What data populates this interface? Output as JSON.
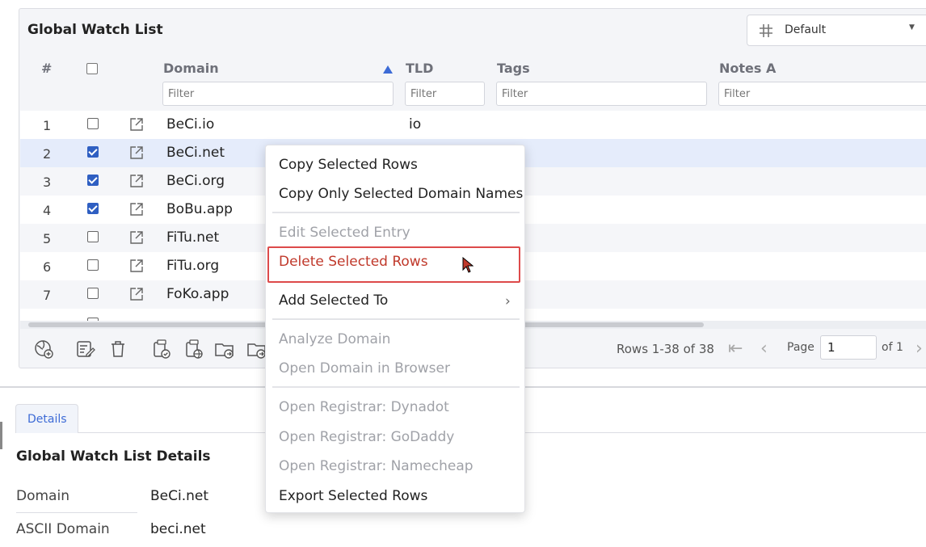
{
  "grid": {
    "title": "Global Watch List",
    "view_select": {
      "value": "Default"
    },
    "columns": {
      "num": "#",
      "domain": "Domain",
      "tld": "TLD",
      "tags": "Tags",
      "notes": "Notes A"
    },
    "filter_placeholder": "Filter",
    "rows": [
      {
        "num": "1",
        "domain": "BeCi.io",
        "tld": "io",
        "checked": false
      },
      {
        "num": "2",
        "domain": "BeCi.net",
        "tld": "",
        "checked": true
      },
      {
        "num": "3",
        "domain": "BeCi.org",
        "tld": "",
        "checked": true
      },
      {
        "num": "4",
        "domain": "BoBu.app",
        "tld": "",
        "checked": true
      },
      {
        "num": "5",
        "domain": "FiTu.net",
        "tld": "",
        "checked": false
      },
      {
        "num": "6",
        "domain": "FiTu.org",
        "tld": "",
        "checked": false
      },
      {
        "num": "7",
        "domain": "FoKo.app",
        "tld": "",
        "checked": false
      }
    ],
    "pagination": {
      "rows_info": "Rows 1-38 of 38",
      "page_label": "Page",
      "page_value": "1",
      "of_label": "of 1"
    }
  },
  "context_menu": {
    "items": [
      "Copy Selected Rows",
      "Copy Only Selected Domain Names",
      "Edit Selected Entry",
      "Delete Selected Rows",
      "Add Selected To",
      "Analyze Domain",
      "Open Domain in Browser",
      "Open Registrar: Dynadot",
      "Open Registrar: GoDaddy",
      "Open Registrar: Namecheap",
      "Export Selected Rows"
    ],
    "submenu_arrow": "›"
  },
  "details": {
    "tab_label": "Details",
    "title": "Global Watch List Details",
    "fields": [
      {
        "key": "Domain",
        "value": "BeCi.net"
      },
      {
        "key": "ASCII Domain",
        "value": "beci.net"
      }
    ]
  },
  "colors": {
    "accent": "#3d6bd6",
    "checkbox": "#2f5fc2",
    "danger": "#c0392b",
    "highlight_border": "#dd4a4a",
    "selected_row": "#e5ecfb"
  }
}
